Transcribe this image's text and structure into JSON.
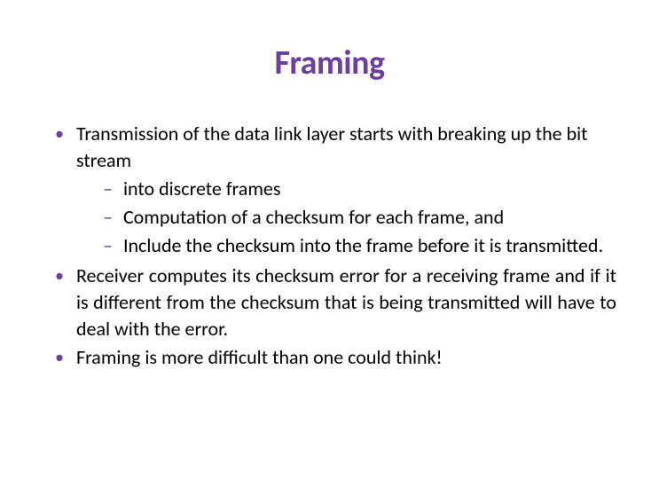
{
  "title": "Framing",
  "bullets": [
    {
      "text": "Transmission of the data link layer starts with breaking up the bit stream",
      "justify": false,
      "sub": [
        {
          "text": "into discrete frames",
          "justify": false
        },
        {
          "text": "Computation of a checksum for each frame, and",
          "justify": false
        },
        {
          "text": "Include the checksum into the frame before it is transmitted.",
          "justify": true
        }
      ]
    },
    {
      "text": "Receiver computes its checksum error for a receiving frame and if it is different from the checksum that is being transmitted will have to deal with the error.",
      "justify": true,
      "sub": []
    },
    {
      "text": "Framing is more difficult than one could think!",
      "justify": false,
      "sub": []
    }
  ]
}
